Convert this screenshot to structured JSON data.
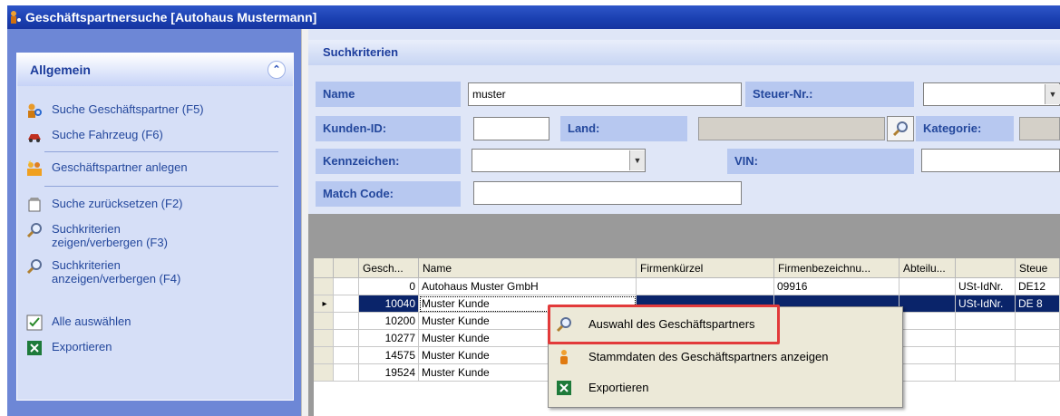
{
  "window": {
    "title": "Geschäftspartnersuche [Autohaus Mustermann]"
  },
  "sidebar": {
    "title": "Allgemein",
    "collapse_icon": "chevron-up-double-icon",
    "items": [
      {
        "label": "Suche Geschäftspartner (F5)",
        "icon": "person-search-icon"
      },
      {
        "label": "Suche Fahrzeug (F6)",
        "icon": "car-icon"
      },
      {
        "label": "Geschäftspartner anlegen",
        "icon": "people-add-icon"
      },
      {
        "label": "Suche zurücksetzen (F2)",
        "icon": "reset-icon"
      },
      {
        "label": "Suchkriterien\nzeigen/verbergen (F3)",
        "line1": "Suchkriterien",
        "line2": "zeigen/verbergen (F3)",
        "icon": "magnifier-icon"
      },
      {
        "label": "Suchkriterien\nanzeigen/verbergen (F4)",
        "line1": "Suchkriterien",
        "line2": "anzeigen/verbergen (F4)",
        "icon": "magnifier-icon"
      },
      {
        "label": "Alle auswählen",
        "icon": "select-all-icon"
      },
      {
        "label": "Exportieren",
        "icon": "excel-icon"
      }
    ]
  },
  "criteria": {
    "title": "Suchkriterien",
    "name_label": "Name",
    "name_value": "muster",
    "steuer_label": "Steuer-Nr.:",
    "kunden_label": "Kunden-ID:",
    "kunden_value": "",
    "land_label": "Land:",
    "land_value": "",
    "kategorie_label": "Kategorie:",
    "kennzeichen_label": "Kennzeichen:",
    "vin_label": "VIN:",
    "matchcode_label": "Match Code:"
  },
  "grid": {
    "headers": [
      "Gesch...",
      "Name",
      "Firmenkürzel",
      "Firmenbezeichnu...",
      "Abteilu...",
      "",
      "Steue"
    ],
    "rows": [
      {
        "id": "0",
        "name": "Autohaus Muster GmbH",
        "kuerzel": "",
        "bez": "09916",
        "abt": "",
        "ust": "USt-IdNr.",
        "steuer": "DE12"
      },
      {
        "id": "10040",
        "name": "Muster Kunde",
        "kuerzel": "",
        "bez": "",
        "abt": "",
        "ust": "USt-IdNr.",
        "steuer": "DE 8"
      },
      {
        "id": "10200",
        "name": "Muster Kunde",
        "kuerzel": "",
        "bez": "",
        "abt": "",
        "ust": "",
        "steuer": ""
      },
      {
        "id": "10277",
        "name": "Muster Kunde",
        "kuerzel": "",
        "bez": "",
        "abt": "",
        "ust": "",
        "steuer": ""
      },
      {
        "id": "14575",
        "name": "Muster Kunde",
        "kuerzel": "",
        "bez": "",
        "abt": "",
        "ust": "",
        "steuer": ""
      },
      {
        "id": "19524",
        "name": "Muster Kunde",
        "kuerzel": "",
        "bez": "",
        "abt": "",
        "ust": "",
        "steuer": ""
      }
    ],
    "selected_row": 1
  },
  "context_menu": {
    "items": [
      {
        "label": "Auswahl des Geschäftspartners",
        "icon": "magnifier-icon"
      },
      {
        "label": "Stammdaten des Geschäftspartners anzeigen",
        "icon": "person-icon"
      },
      {
        "label": "Exportieren",
        "icon": "excel-icon"
      }
    ],
    "highlight_color": "#e23a3a"
  },
  "colors": {
    "title_bar": "#1a3fb0",
    "panel_bg": "#d6dff7",
    "label_bg": "#b7c8f0",
    "selection": "#0a246a"
  }
}
